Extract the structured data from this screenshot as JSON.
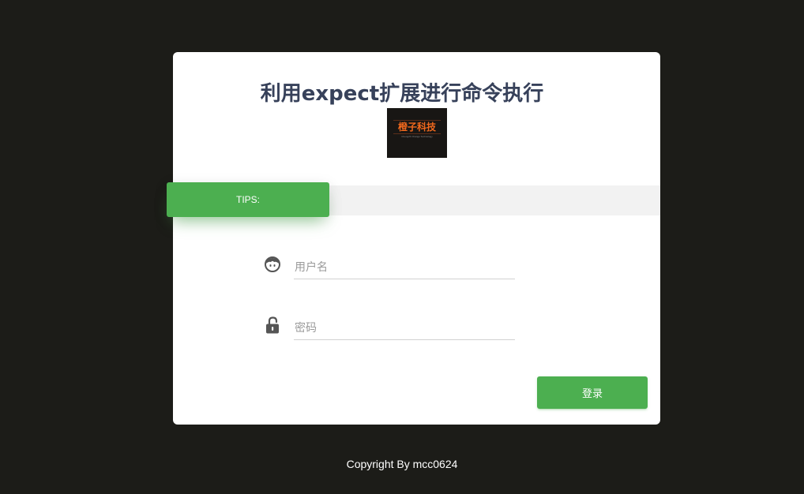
{
  "page": {
    "title": "利用expect扩展进行命令执行"
  },
  "logo": {
    "main_text": "橙子科技",
    "sub_text": "Chengzhi Orange Technology",
    "icon": "company-logo"
  },
  "tips": {
    "label": "TIPS:"
  },
  "form": {
    "username": {
      "placeholder": "用户名",
      "value": "",
      "icon": "user-face-icon"
    },
    "password": {
      "placeholder": "密码",
      "value": "",
      "icon": "unlocked-padlock-icon"
    },
    "submit_label": "登录"
  },
  "footer": {
    "copyright": "Copyright By mcc0624"
  },
  "colors": {
    "background": "#1c1c18",
    "card": "#ffffff",
    "accent": "#4caf50",
    "title": "#37415a",
    "tips_strip": "#f2f2f2"
  }
}
